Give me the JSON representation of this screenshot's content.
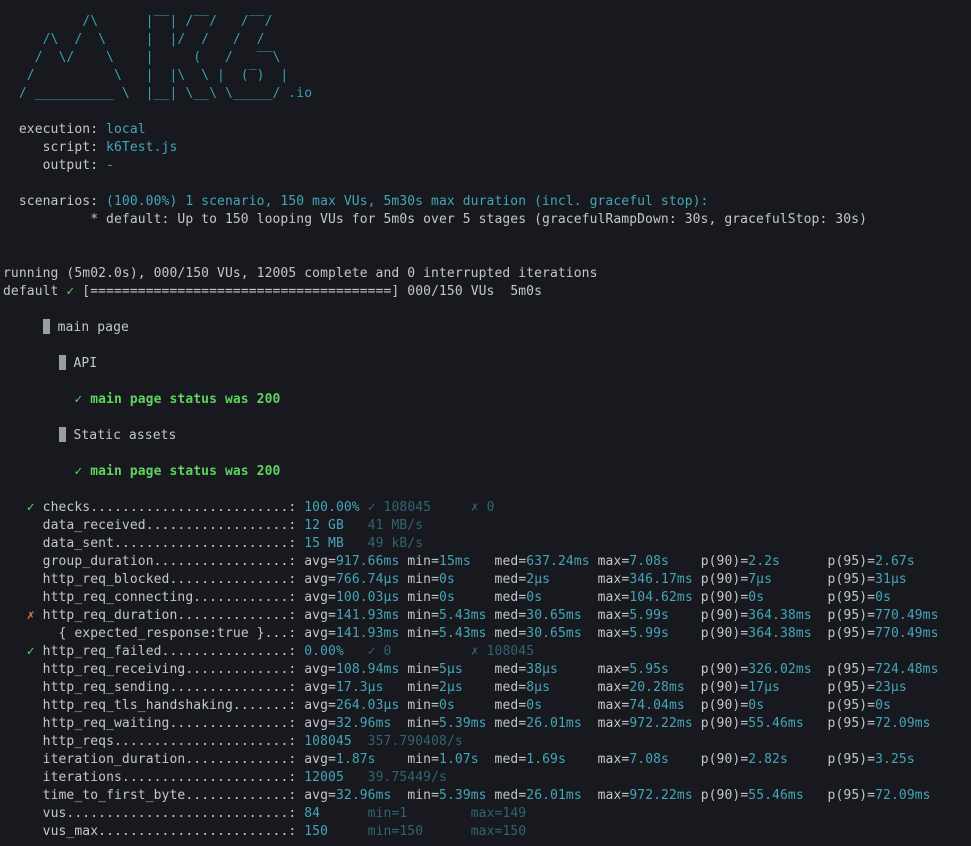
{
  "logo": {
    "lines": [
      "          /\\      |‾‾| /‾‾/   /‾‾/   ",
      "     /\\  /  \\     |  |/  /   /  /    ",
      "    /  \\/    \\    |     (   /   ‾‾\\  ",
      "   /          \\   |  |\\  \\ |  (‾)  | ",
      "  / __________ \\  |__| \\__\\ \\_____/ "
    ],
    "suffix": ".io"
  },
  "run_info": {
    "execution_label": "  execution: ",
    "execution_value": "local",
    "script_label": "     script: ",
    "script_value": "k6Test.js",
    "output_label": "     output: ",
    "output_value": "-",
    "scenarios_label": "  scenarios: ",
    "scenarios_value": "(100.00%) 1 scenario, 150 max VUs, 5m30s max duration (incl. graceful stop):",
    "scenario_detail": "           * default: Up to 150 looping VUs for 5m0s over 5 stages (gracefulRampDown: 30s, gracefulStop: 30s)"
  },
  "progress": {
    "running": "running (5m02.0s), 000/150 VUs, 12005 complete and 0 interrupted iterations",
    "scenario": "default ",
    "check": "✓",
    "bar": " [======================================]",
    "vus": " 000/150 VUs  5m0s",
    "percent_complete": 100
  },
  "groups": {
    "main_group": "main page",
    "api_group": "API",
    "api_check": "✓ main page status was 200",
    "static_group": "Static assets",
    "static_check": "✓ main page status was 200"
  },
  "colors": {
    "background": "#17191e",
    "text": "#c3c6ca",
    "value": "#45a5b8",
    "dim": "#2f6571",
    "pass": "#5fd35f",
    "fail": "#e8735a"
  },
  "metrics": [
    {
      "mark": "✓",
      "name": "checks.........................",
      "simple": [
        "100.00%",
        "✓ 108045",
        "✗ 0"
      ]
    },
    {
      "mark": "",
      "name": "data_received..................",
      "simple": [
        "12 GB",
        "41 MB/s",
        ""
      ]
    },
    {
      "mark": "",
      "name": "data_sent......................",
      "simple": [
        "15 MB",
        "49 kB/s",
        ""
      ]
    },
    {
      "mark": "",
      "name": "group_duration.................",
      "stats": [
        [
          "avg=",
          "917.66ms"
        ],
        [
          "min=",
          "15ms"
        ],
        [
          "med=",
          "637.24ms"
        ],
        [
          "max=",
          "7.08s"
        ],
        [
          "p(90)=",
          "2.2s"
        ],
        [
          "p(95)=",
          "2.67s"
        ]
      ]
    },
    {
      "mark": "",
      "name": "http_req_blocked...............",
      "stats": [
        [
          "avg=",
          "766.74µs"
        ],
        [
          "min=",
          "0s"
        ],
        [
          "med=",
          "2µs"
        ],
        [
          "max=",
          "346.17ms"
        ],
        [
          "p(90)=",
          "7µs"
        ],
        [
          "p(95)=",
          "31µs"
        ]
      ]
    },
    {
      "mark": "",
      "name": "http_req_connecting............",
      "stats": [
        [
          "avg=",
          "100.03µs"
        ],
        [
          "min=",
          "0s"
        ],
        [
          "med=",
          "0s"
        ],
        [
          "max=",
          "104.62ms"
        ],
        [
          "p(90)=",
          "0s"
        ],
        [
          "p(95)=",
          "0s"
        ]
      ]
    },
    {
      "mark": "✗",
      "name": "http_req_duration..............",
      "stats": [
        [
          "avg=",
          "141.93ms"
        ],
        [
          "min=",
          "5.43ms"
        ],
        [
          "med=",
          "30.65ms"
        ],
        [
          "max=",
          "5.99s"
        ],
        [
          "p(90)=",
          "364.38ms"
        ],
        [
          "p(95)=",
          "770.49ms"
        ]
      ]
    },
    {
      "mark": "",
      "name": "  { expected_response:true }...",
      "stats": [
        [
          "avg=",
          "141.93ms"
        ],
        [
          "min=",
          "5.43ms"
        ],
        [
          "med=",
          "30.65ms"
        ],
        [
          "max=",
          "5.99s"
        ],
        [
          "p(90)=",
          "364.38ms"
        ],
        [
          "p(95)=",
          "770.49ms"
        ]
      ]
    },
    {
      "mark": "✓",
      "name": "http_req_failed................",
      "simple": [
        "0.00%",
        "✓ 0",
        "✗ 108045"
      ]
    },
    {
      "mark": "",
      "name": "http_req_receiving.............",
      "stats": [
        [
          "avg=",
          "108.94ms"
        ],
        [
          "min=",
          "5µs"
        ],
        [
          "med=",
          "38µs"
        ],
        [
          "max=",
          "5.95s"
        ],
        [
          "p(90)=",
          "326.02ms"
        ],
        [
          "p(95)=",
          "724.48ms"
        ]
      ]
    },
    {
      "mark": "",
      "name": "http_req_sending...............",
      "stats": [
        [
          "avg=",
          "17.3µs"
        ],
        [
          "min=",
          "2µs"
        ],
        [
          "med=",
          "8µs"
        ],
        [
          "max=",
          "20.28ms"
        ],
        [
          "p(90)=",
          "17µs"
        ],
        [
          "p(95)=",
          "23µs"
        ]
      ]
    },
    {
      "mark": "",
      "name": "http_req_tls_handshaking.......",
      "stats": [
        [
          "avg=",
          "264.03µs"
        ],
        [
          "min=",
          "0s"
        ],
        [
          "med=",
          "0s"
        ],
        [
          "max=",
          "74.04ms"
        ],
        [
          "p(90)=",
          "0s"
        ],
        [
          "p(95)=",
          "0s"
        ]
      ]
    },
    {
      "mark": "",
      "name": "http_req_waiting...............",
      "stats": [
        [
          "avg=",
          "32.96ms"
        ],
        [
          "min=",
          "5.39ms"
        ],
        [
          "med=",
          "26.01ms"
        ],
        [
          "max=",
          "972.22ms"
        ],
        [
          "p(90)=",
          "55.46ms"
        ],
        [
          "p(95)=",
          "72.09ms"
        ]
      ]
    },
    {
      "mark": "",
      "name": "http_reqs......................",
      "simple": [
        "108045",
        "357.790408/s",
        ""
      ]
    },
    {
      "mark": "",
      "name": "iteration_duration.............",
      "stats": [
        [
          "avg=",
          "1.87s"
        ],
        [
          "min=",
          "1.07s"
        ],
        [
          "med=",
          "1.69s"
        ],
        [
          "max=",
          "7.08s"
        ],
        [
          "p(90)=",
          "2.82s"
        ],
        [
          "p(95)=",
          "3.25s"
        ]
      ]
    },
    {
      "mark": "",
      "name": "iterations.....................",
      "simple": [
        "12005",
        "39.75449/s",
        ""
      ]
    },
    {
      "mark": "",
      "name": "time_to_first_byte.............",
      "stats": [
        [
          "avg=",
          "32.96ms"
        ],
        [
          "min=",
          "5.39ms"
        ],
        [
          "med=",
          "26.01ms"
        ],
        [
          "max=",
          "972.22ms"
        ],
        [
          "p(90)=",
          "55.46ms"
        ],
        [
          "p(95)=",
          "72.09ms"
        ]
      ]
    },
    {
      "mark": "",
      "name": "vus............................",
      "simple": [
        "84",
        "min=1",
        "max=149"
      ]
    },
    {
      "mark": "",
      "name": "vus_max........................",
      "simple": [
        "150",
        "min=150",
        "max=150"
      ]
    }
  ]
}
